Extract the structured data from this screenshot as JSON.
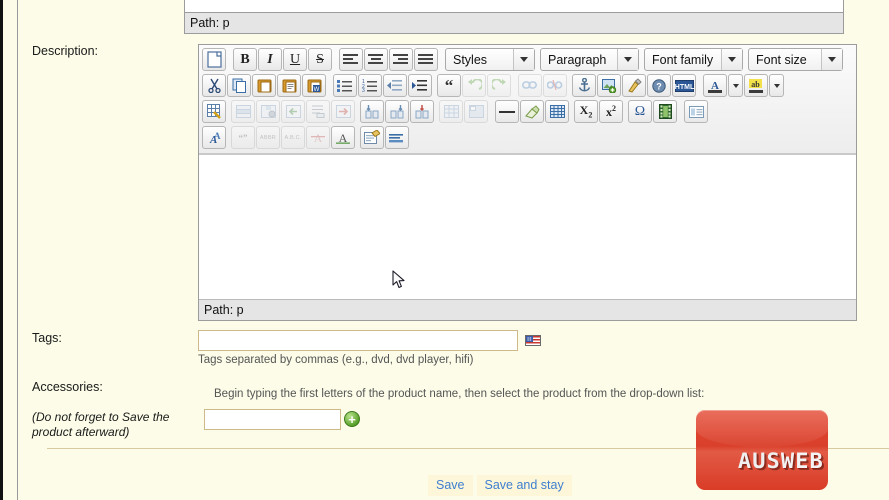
{
  "form": {
    "description_label": "Description:",
    "tags_label": "Tags:",
    "accessories_label": "Accessories:",
    "accessories_note": "(Do not forget to Save the product afterward)"
  },
  "editor_top": {
    "path_label": "Path: p"
  },
  "editor": {
    "path_label": "Path: p",
    "toolbar": {
      "row1": [
        {
          "name": "new-document-icon",
          "title": "New document"
        },
        {
          "name": "bold-icon",
          "title": "Bold",
          "text": "B"
        },
        {
          "name": "italic-icon",
          "title": "Italic",
          "text": "I"
        },
        {
          "name": "underline-icon",
          "title": "Underline",
          "text": "U"
        },
        {
          "name": "strikethrough-icon",
          "title": "Strikethrough",
          "text": "S"
        },
        {
          "name": "align-left-icon",
          "title": "Align left"
        },
        {
          "name": "align-center-icon",
          "title": "Align center"
        },
        {
          "name": "align-right-icon",
          "title": "Align right"
        },
        {
          "name": "align-justify-icon",
          "title": "Align full"
        }
      ],
      "row2": [
        {
          "name": "cut-icon",
          "title": "Cut"
        },
        {
          "name": "copy-icon",
          "title": "Copy"
        },
        {
          "name": "paste-icon",
          "title": "Paste"
        },
        {
          "name": "paste-text-icon",
          "title": "Paste as plain text"
        },
        {
          "name": "paste-word-icon",
          "title": "Paste from Word"
        },
        {
          "name": "unordered-list-icon",
          "title": "Unordered list"
        },
        {
          "name": "ordered-list-icon",
          "title": "Ordered list"
        },
        {
          "name": "outdent-icon",
          "title": "Outdent"
        },
        {
          "name": "indent-icon",
          "title": "Indent"
        },
        {
          "name": "blockquote-icon",
          "title": "Blockquote"
        },
        {
          "name": "undo-icon",
          "title": "Undo",
          "disabled": true
        },
        {
          "name": "redo-icon",
          "title": "Redo",
          "disabled": true
        },
        {
          "name": "link-icon",
          "title": "Insert/edit link",
          "disabled": true
        },
        {
          "name": "unlink-icon",
          "title": "Unlink",
          "disabled": true
        },
        {
          "name": "anchor-icon",
          "title": "Insert/edit anchor"
        },
        {
          "name": "image-icon",
          "title": "Insert/edit image"
        },
        {
          "name": "cleanup-icon",
          "title": "Cleanup messy code"
        },
        {
          "name": "help-icon",
          "title": "Help"
        },
        {
          "name": "html-source-icon",
          "title": "Edit HTML source"
        },
        {
          "name": "text-color-icon",
          "title": "Select text color"
        },
        {
          "name": "text-color-dropdown-icon",
          "title": "Text color options"
        },
        {
          "name": "background-color-icon",
          "title": "Select background color"
        },
        {
          "name": "background-color-dropdown-icon",
          "title": "Background color options"
        }
      ],
      "row3": [
        {
          "name": "insert-table-icon",
          "title": "Inserts a new table"
        },
        {
          "name": "table-row-properties-icon",
          "title": "Table row properties",
          "disabled": true
        },
        {
          "name": "table-cell-properties-icon",
          "title": "Table cell properties",
          "disabled": true
        },
        {
          "name": "insert-row-before-icon",
          "title": "Insert row before",
          "disabled": true
        },
        {
          "name": "insert-row-after-icon",
          "title": "Insert row after",
          "disabled": true
        },
        {
          "name": "delete-row-icon",
          "title": "Delete row",
          "disabled": true
        },
        {
          "name": "insert-column-before-icon",
          "title": "Insert column before"
        },
        {
          "name": "insert-column-after-icon",
          "title": "Insert column after"
        },
        {
          "name": "delete-column-icon",
          "title": "Delete column"
        },
        {
          "name": "split-cells-icon",
          "title": "Split merged table cells",
          "disabled": true
        },
        {
          "name": "merge-cells-icon",
          "title": "Merge table cells",
          "disabled": true
        },
        {
          "name": "horizontal-rule-icon",
          "title": "Insert horizontal ruler"
        },
        {
          "name": "remove-formatting-icon",
          "title": "Remove formatting"
        },
        {
          "name": "toggle-guidelines-icon",
          "title": "Toggle guidelines/invisible elements"
        },
        {
          "name": "subscript-icon",
          "title": "Subscript"
        },
        {
          "name": "superscript-icon",
          "title": "Superscript"
        },
        {
          "name": "special-character-icon",
          "title": "Insert custom character"
        },
        {
          "name": "media-icon",
          "title": "Insert / edit embedded media"
        },
        {
          "name": "page-break-icon",
          "title": "Insert page break"
        }
      ],
      "row4": [
        {
          "name": "spellcheck-icon",
          "title": "Toggle spellchecker"
        },
        {
          "name": "citation-icon",
          "title": "Citation",
          "disabled": true
        },
        {
          "name": "abbreviation-icon",
          "title": "Abbreviation",
          "text": "ABBR",
          "disabled": true
        },
        {
          "name": "acronym-icon",
          "title": "Acronym",
          "text": "A.B.C.",
          "disabled": true
        },
        {
          "name": "delete-text-icon",
          "title": "Deletion",
          "disabled": true
        },
        {
          "name": "insert-text-icon",
          "title": "Insertion"
        },
        {
          "name": "attributes-icon",
          "title": "Insert/edit attributes"
        },
        {
          "name": "visualchars-icon",
          "title": "Visual control characters on/off"
        }
      ],
      "dropdowns": [
        {
          "name": "styles-select",
          "label": "Styles"
        },
        {
          "name": "paragraph-select",
          "label": "Paragraph"
        },
        {
          "name": "font-family-select",
          "label": "Font family"
        },
        {
          "name": "font-size-select",
          "label": "Font size"
        }
      ]
    },
    "content": ""
  },
  "tags": {
    "value": "",
    "hint": "Tags separated by commas (e.g., dvd, dvd player, hifi)",
    "flag_icon": "us-flag-icon"
  },
  "accessories": {
    "instruction": "Begin typing the first letters of the product name, then select the product from the drop-down list:",
    "value": "",
    "add_icon": "add-plus-icon"
  },
  "actions": {
    "save_label": "Save",
    "save_and_stay_label": "Save and stay"
  },
  "branding": {
    "logo_text_1": "AUS",
    "logo_text_2": "WEB",
    "logo_color": "#dc3c27"
  }
}
